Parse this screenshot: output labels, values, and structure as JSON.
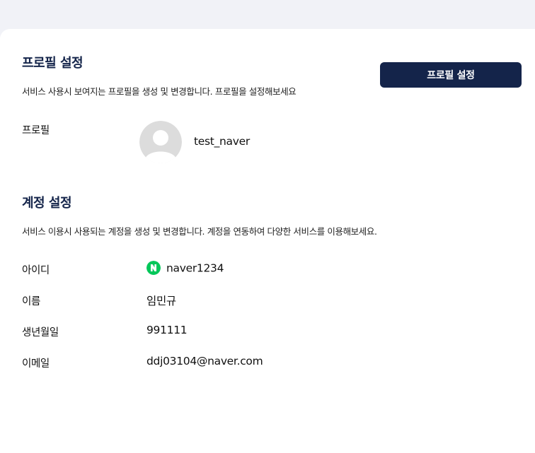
{
  "profile_section": {
    "title": "프로필 설정",
    "description": "서비스 사용시 보여지는 프로필을 생성 및 변경합니다. 프로필을 설정해보세요",
    "button_label": "프로필 설정",
    "profile_label": "프로필",
    "nickname": "test_naver"
  },
  "account_section": {
    "title": "계정 설정",
    "description": "서비스 이용시 사용되는 계정을 생성 및 변경합니다. 계정을 연동하여 다양한 서비스를 이용해보세요.",
    "rows": [
      {
        "label": "아이디",
        "value": "naver1234",
        "provider_icon": "naver-icon"
      },
      {
        "label": "이름",
        "value": "임민규"
      },
      {
        "label": "생년월일",
        "value": "991111"
      },
      {
        "label": "이메일",
        "value": "ddj03104@naver.com"
      }
    ]
  },
  "colors": {
    "page_bg": "#f1f2f7",
    "card_bg": "#ffffff",
    "primary": "#14244a",
    "naver_green": "#03c75a",
    "avatar_gray": "#dcdcdc"
  }
}
